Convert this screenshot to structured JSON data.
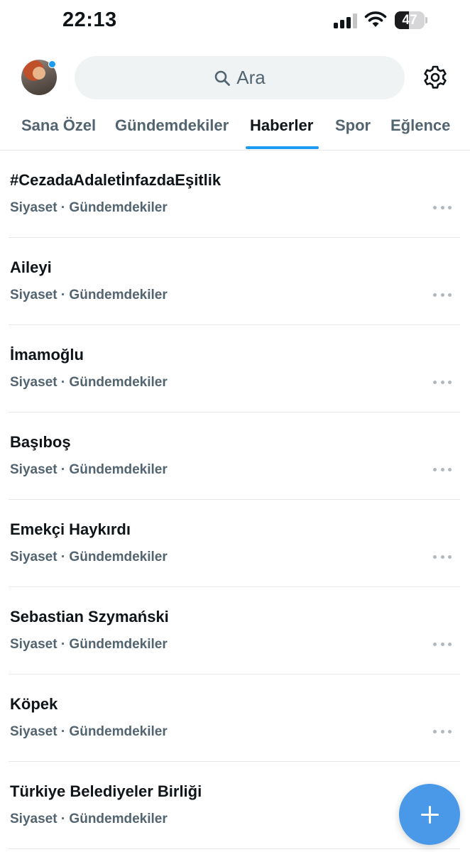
{
  "status_bar": {
    "time": "22:13",
    "battery": "47",
    "battery_level": 0.47
  },
  "header": {
    "avatar_icon": "profile-avatar",
    "notification_dot_color": "#1d9bf0",
    "search_placeholder": "Ara",
    "search_icon": "search-icon",
    "settings_icon": "gear-icon"
  },
  "tabs": [
    {
      "label": "Sana Özel",
      "active": false
    },
    {
      "label": "Gündemdekiler",
      "active": false
    },
    {
      "label": "Haberler",
      "active": true
    },
    {
      "label": "Spor",
      "active": false
    },
    {
      "label": "Eğlence",
      "active": false
    }
  ],
  "trends": [
    {
      "title": "#CezadaAdaletİnfazdaEşitlik",
      "meta": "Siyaset · Gündemdekiler"
    },
    {
      "title": "Aileyi",
      "meta": "Siyaset · Gündemdekiler"
    },
    {
      "title": "İmamoğlu",
      "meta": "Siyaset · Gündemdekiler"
    },
    {
      "title": "Başıboş",
      "meta": "Siyaset · Gündemdekiler"
    },
    {
      "title": "Emekçi Haykırdı",
      "meta": "Siyaset · Gündemdekiler"
    },
    {
      "title": "Sebastian Szymański",
      "meta": "Siyaset · Gündemdekiler"
    },
    {
      "title": "Köpek",
      "meta": "Siyaset · Gündemdekiler"
    },
    {
      "title": "Türkiye Belediyeler Birliği",
      "meta": "Siyaset · Gündemdekiler"
    }
  ],
  "fab_icon": "plus-icon",
  "colors": {
    "accent": "#1d9bf0",
    "fab": "#4a99e9",
    "text_primary": "#0f1419",
    "text_secondary": "#536471"
  }
}
